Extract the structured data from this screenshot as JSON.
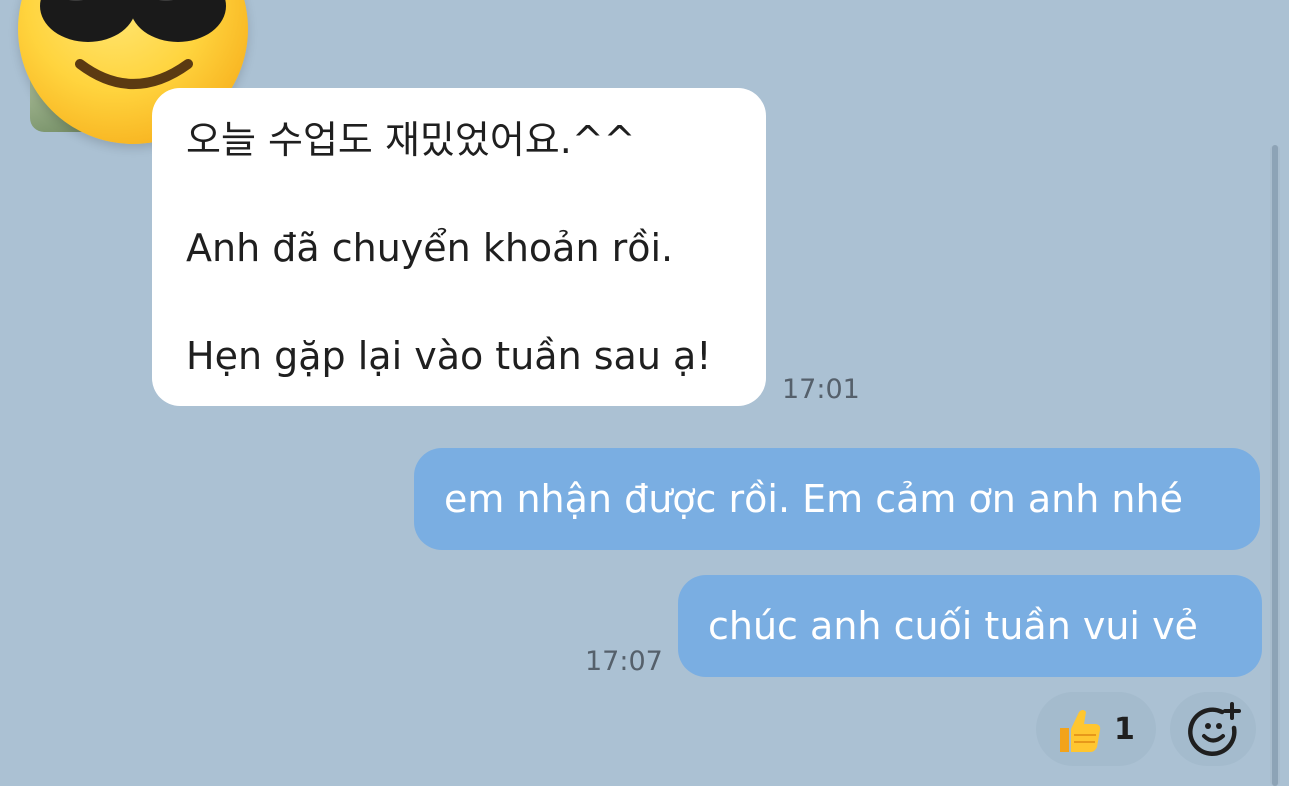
{
  "incoming": {
    "lines": [
      "오늘 수업도 재밌었어요.^^",
      "Anh đã chuyển khoản rồi.",
      "Hẹn gặp lại vào tuần sau ạ!"
    ],
    "time": "17:01"
  },
  "outgoing": {
    "messages": [
      "em nhận được rồi. Em cảm ơn anh nhé",
      "chúc anh cuối tuần vui vẻ"
    ],
    "time": "17:07"
  },
  "reactions": {
    "thumbs_up_icon": "thumbs-up-icon",
    "thumbs_up_count": "1",
    "add_reaction_icon": "add-reaction-icon"
  },
  "colors": {
    "background": "#abc1d3",
    "incoming_bubble": "#ffffff",
    "outgoing_bubble": "#7aaee2"
  }
}
